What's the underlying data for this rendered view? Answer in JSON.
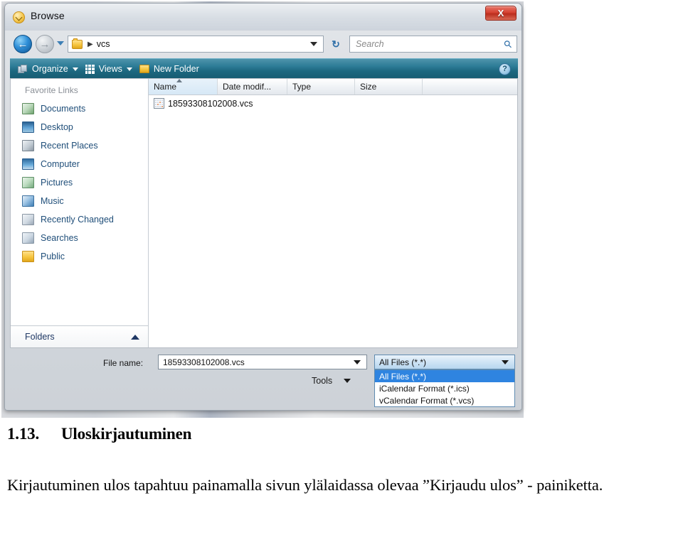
{
  "window": {
    "title": "Browse",
    "title_icon": "browse-circle-icon",
    "close_label": "X"
  },
  "navbar": {
    "back_glyph": "←",
    "forward_glyph": "→",
    "breadcrumb_separator": "▶",
    "breadcrumb": "vcs",
    "refresh_glyph": "↻",
    "search_placeholder": "Search",
    "search_value": "",
    "search_icon_glyph": "⚲"
  },
  "toolbar": {
    "organize_label": "Organize",
    "views_label": "Views",
    "new_folder_label": "New Folder",
    "help_label": "?"
  },
  "sidebar": {
    "title": "Favorite Links",
    "items": [
      {
        "label": "Documents",
        "icon": "documents-icon"
      },
      {
        "label": "Desktop",
        "icon": "desktop-icon"
      },
      {
        "label": "Recent Places",
        "icon": "recent-places-icon"
      },
      {
        "label": "Computer",
        "icon": "computer-icon"
      },
      {
        "label": "Pictures",
        "icon": "pictures-icon"
      },
      {
        "label": "Music",
        "icon": "music-icon"
      },
      {
        "label": "Recently Changed",
        "icon": "recently-changed-icon"
      },
      {
        "label": "Searches",
        "icon": "searches-icon"
      },
      {
        "label": "Public",
        "icon": "public-folder-icon"
      }
    ],
    "folders_label": "Folders",
    "folders_chevron": "chevron-up-icon"
  },
  "filelist": {
    "columns": [
      {
        "label": "Name",
        "sorted": true,
        "sort_direction": "ascending"
      },
      {
        "label": "Date modif...",
        "sorted": false
      },
      {
        "label": "Type",
        "sorted": false
      },
      {
        "label": "Size",
        "sorted": false
      },
      {
        "label": "",
        "sorted": false
      }
    ],
    "rows": [
      {
        "name": "18593308102008.vcs",
        "date_modified": "",
        "type": "",
        "size": "",
        "icon": "calendar-file-icon"
      }
    ]
  },
  "footer": {
    "filename_label": "File name:",
    "filename_value": "18593308102008.vcs",
    "filter_selected": "All Files (*.*)",
    "filter_options": [
      {
        "label": "All Files (*.*)",
        "selected": true
      },
      {
        "label": "iCalendar Format (*.ics)",
        "selected": false
      },
      {
        "label": "vCalendar Format (*.vcs)",
        "selected": false
      }
    ],
    "tools_label": "Tools"
  },
  "document": {
    "heading_number": "1.13.",
    "heading_title": "Uloskirjautuminen",
    "paragraph": "Kirjautuminen ulos tapahtuu painamalla sivun ylälaidassa olevaa ”Kirjaudu ulos” - painiketta."
  },
  "colors": {
    "toolbar_teal": "#1d6880",
    "close_red": "#d64232",
    "link_blue": "#1f4e79",
    "selection_blue": "#2f84e0",
    "folder_yellow": "#f6c53f"
  }
}
